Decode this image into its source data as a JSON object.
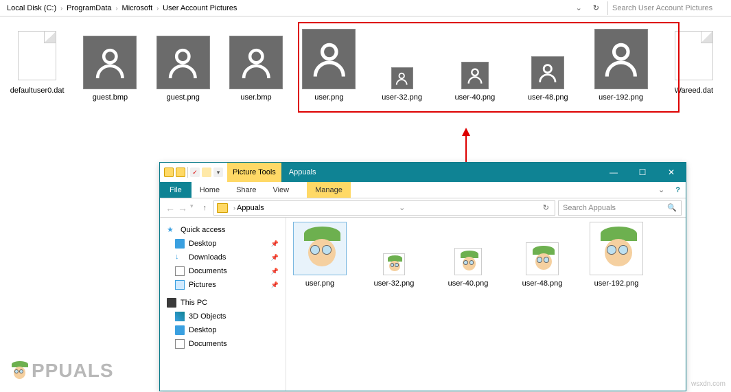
{
  "top": {
    "path": [
      "Local Disk (C:)",
      "ProgramData",
      "Microsoft",
      "User Account Pictures"
    ],
    "search_placeholder": "Search User Account Pictures",
    "files": [
      {
        "name": "defaultuser0.dat",
        "kind": "blank"
      },
      {
        "name": "guest.bmp",
        "kind": "person",
        "size": 78
      },
      {
        "name": "guest.png",
        "kind": "person",
        "size": 78
      },
      {
        "name": "user.bmp",
        "kind": "person",
        "size": 78
      },
      {
        "name": "user.png",
        "kind": "person",
        "size": 88
      },
      {
        "name": "user-32.png",
        "kind": "person",
        "size": 32
      },
      {
        "name": "user-40.png",
        "kind": "person",
        "size": 40
      },
      {
        "name": "user-48.png",
        "kind": "person",
        "size": 48
      },
      {
        "name": "user-192.png",
        "kind": "person",
        "size": 88
      },
      {
        "name": "Wareed.dat",
        "kind": "blank"
      }
    ]
  },
  "win2": {
    "tools_label": "Picture Tools",
    "title": "Appuals",
    "tabs": {
      "file": "File",
      "home": "Home",
      "share": "Share",
      "view": "View",
      "manage": "Manage"
    },
    "breadcrumb": "Appuals",
    "search_placeholder": "Search Appuals",
    "sidebar": {
      "quick": "Quick access",
      "items_quick": [
        "Desktop",
        "Downloads",
        "Documents",
        "Pictures"
      ],
      "pc": "This PC",
      "items_pc": [
        "3D Objects",
        "Desktop",
        "Documents"
      ]
    },
    "files": [
      {
        "name": "user.png",
        "size": 78,
        "selected": true
      },
      {
        "name": "user-32.png",
        "size": 32
      },
      {
        "name": "user-40.png",
        "size": 40
      },
      {
        "name": "user-48.png",
        "size": 48
      },
      {
        "name": "user-192.png",
        "size": 78
      }
    ]
  },
  "watermark": "PPUALS",
  "source": "wsxdn.com"
}
